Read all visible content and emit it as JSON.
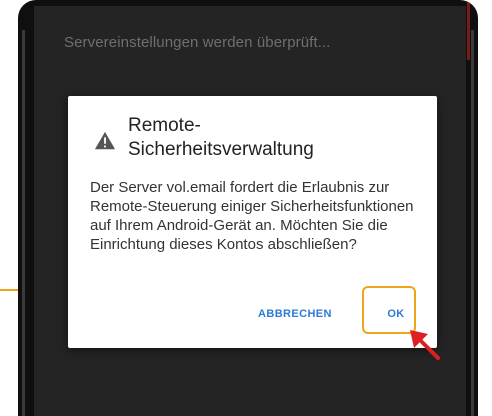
{
  "background": {
    "status_text": "Servereinstellungen werden überprüft..."
  },
  "dialog": {
    "title": "Remote-\nSicherheitsverwaltung",
    "title_line1": "Remote-",
    "title_line2": "Sicherheitsverwaltung",
    "body": "Der Server vol.email fordert die Erlaubnis zur Remote-Steuerung einiger Sicherheitsfunktionen auf Ihrem Android-Gerät an. Möchten Sie die Einrichtung dieses Kontos abschließen?",
    "cancel_label": "ABBRECHEN",
    "ok_label": "OK",
    "icon": "warning-icon"
  },
  "colors": {
    "accent": "#2b7bd6",
    "highlight": "#f0a41a",
    "arrow": "#e02020"
  }
}
